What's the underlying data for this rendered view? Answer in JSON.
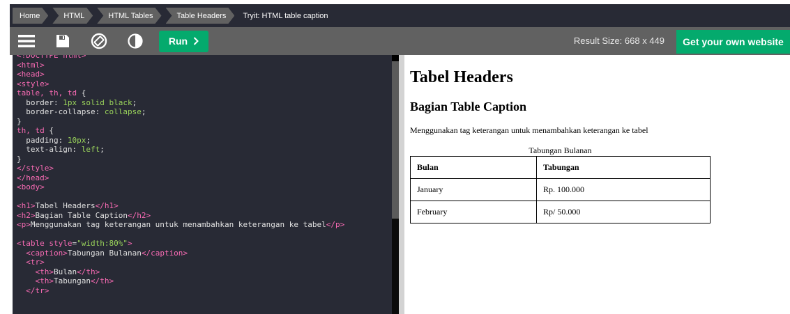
{
  "breadcrumb": {
    "items": [
      "Home",
      "HTML",
      "HTML Tables",
      "Table Headers"
    ],
    "current": "Tryit: HTML table caption"
  },
  "toolbar": {
    "icons": [
      "menu-icon",
      "save-icon",
      "rotate-icon",
      "contrast-icon"
    ],
    "run_label": "Run",
    "result_size": "Result Size: 668 x 449",
    "get_website": "Get your own website"
  },
  "editor": {
    "lines": [
      "<!DOCTYPE html>",
      "<html>",
      "<head>",
      "<style>",
      "table, th, td {",
      "  border: 1px solid black;",
      "  border-collapse: collapse;",
      "}",
      "th, td {",
      "  padding: 10px;",
      "  text-align: left;",
      "}",
      "</style>",
      "</head>",
      "<body>",
      "",
      "<h1>Tabel Headers</h1>",
      "<h2>Bagian Table Caption</h2>",
      "<p>Menggunakan tag keterangan untuk menambahkan keterangan ke tabel</p>",
      "",
      "<table style=\"width:80%\">",
      "  <caption>Tabungan Bulanan</caption>",
      "  <tr>",
      "    <th>Bulan</th>",
      "    <th>Tabungan</th>",
      "  </tr>"
    ]
  },
  "result": {
    "h1": "Tabel Headers",
    "h2": "Bagian Table Caption",
    "paragraph": "Menggunakan tag keterangan untuk menambahkan keterangan ke tabel",
    "caption": "Tabungan Bulanan",
    "headers": [
      "Bulan",
      "Tabungan"
    ],
    "rows": [
      [
        "January",
        "Rp. 100.000"
      ],
      [
        "February",
        "Rp/ 50.000"
      ]
    ]
  }
}
